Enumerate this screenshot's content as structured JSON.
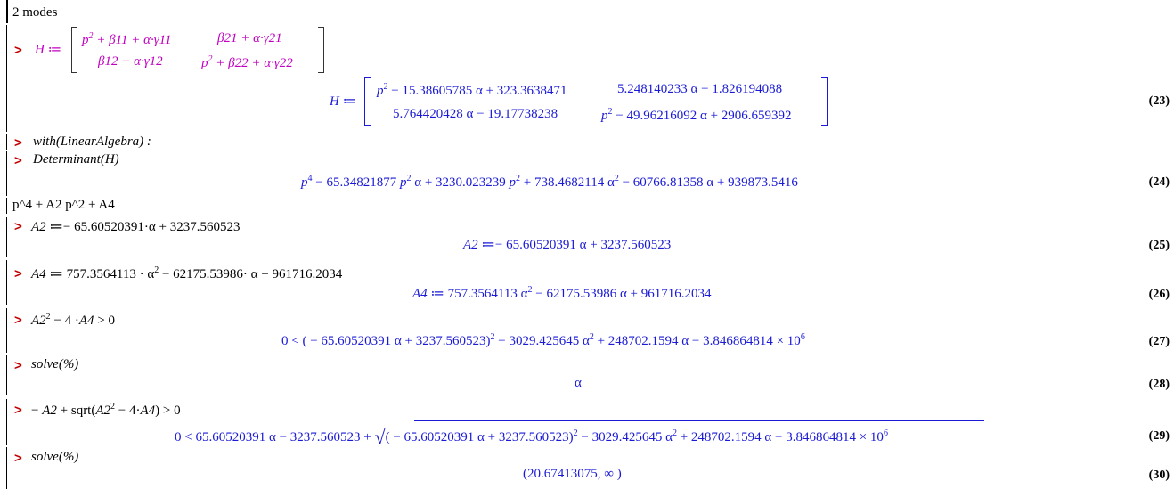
{
  "text_row_1": "2 modes",
  "prompt_symbol": ">",
  "input_H": {
    "lhs": "H ≔",
    "m11": "p2 + β11 + α·γ11",
    "m12": "β21 + α·γ21",
    "m21": "β12 + α·γ12",
    "m22": "p2 + β22 + α·γ22"
  },
  "output_23": {
    "lhs": "H ≔",
    "m11": "p2 − 15.38605785 α + 323.3638471",
    "m12": "5.248140233 α − 1.826194088",
    "m21": "5.764420428 α − 19.17738238",
    "m22": "p2 − 49.96216092 α + 2906.659392",
    "label": "(23)"
  },
  "input_with": "with(LinearAlgebra) :",
  "input_det": "Determinant(H)",
  "output_24": {
    "text": "p4 − 65.34821877 p2 α + 3230.023239 p2 + 738.4682114 α2 − 60766.81358 α + 939873.5416",
    "label": "(24)"
  },
  "text_row_2": "p^4 + A2 p^2 + A4",
  "input_A2": "A2 ≔ − 65.60520391·α + 3237.560523",
  "output_25": {
    "text": "A2 ≔ − 65.60520391 α + 3237.560523",
    "label": "(25)"
  },
  "input_A4": "A4 ≔ 757.3564113 · α2 − 62175.53986· α + 961716.2034",
  "output_26": {
    "text": "A4 ≔ 757.3564113 α2 − 62175.53986 α + 961716.2034",
    "label": "(26)"
  },
  "input_ineq": "A22 − 4 ·A4 > 0",
  "output_27": {
    "text": "0 < ( − 65.60520391 α + 3237.560523)2 − 3029.425645 α2 + 248702.1594 α − 3.846864814 × 106",
    "label": "(27)"
  },
  "input_solve1": "solve(%)",
  "output_28": {
    "text": "α",
    "label": "(28)"
  },
  "input_ineq2": "− A2 + sqrt(A22 − 4·A4) > 0",
  "output_29": {
    "text": "0 < 65.60520391 α − 3237.560523 + √( ( − 65.60520391 α + 3237.560523)2 − 3029.425645 α2 + 248702.1594 α − 3.846864814 × 106)",
    "label": "(29)"
  },
  "input_solve2": "solve(%)",
  "output_30": {
    "text": "(20.67413075, ∞ )",
    "label": "(30)"
  },
  "colors": {
    "prompt": "#c00000",
    "input_math": "#c000c0",
    "output_math": "#1a1ad6"
  }
}
